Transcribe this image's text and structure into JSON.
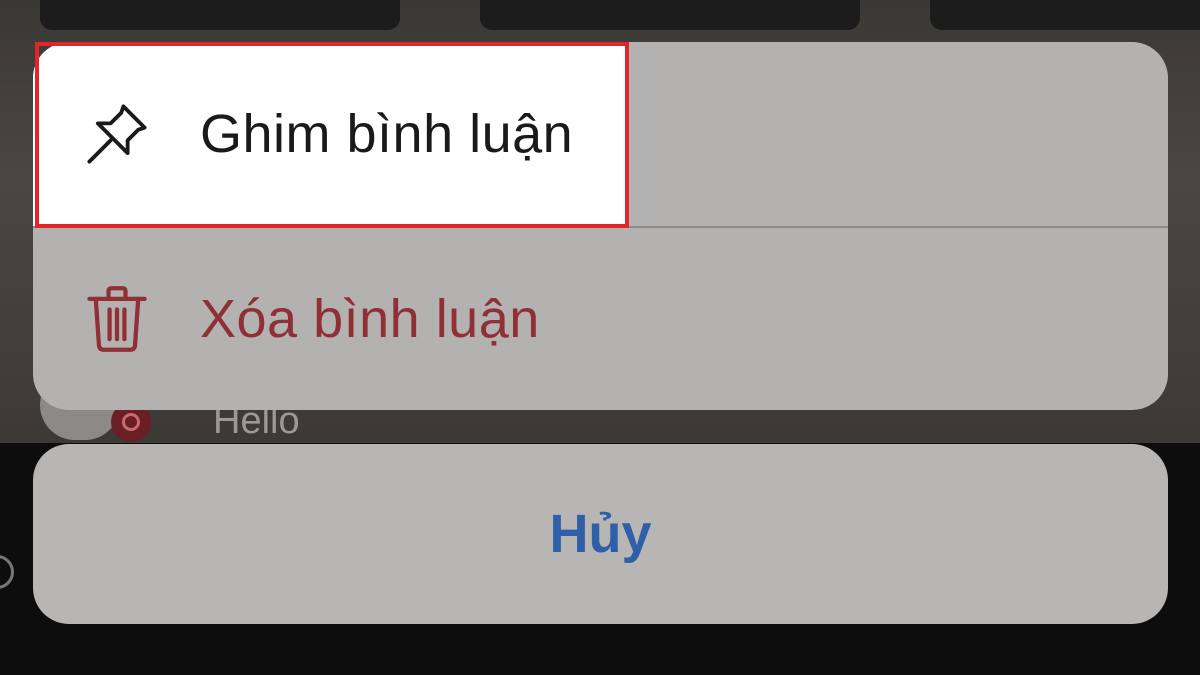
{
  "background": {
    "comment_text": "Hello"
  },
  "action_sheet": {
    "items": [
      {
        "label": "Ghim bình luận",
        "icon": "pin-icon",
        "color": "#1a1a1a",
        "highlighted": true
      },
      {
        "label": "Xóa bình luận",
        "icon": "trash-icon",
        "color": "#8f2f36",
        "highlighted": false
      }
    ],
    "highlight_color": "#e0262b"
  },
  "cancel": {
    "label": "Hủy",
    "color": "#2f5fa8"
  }
}
